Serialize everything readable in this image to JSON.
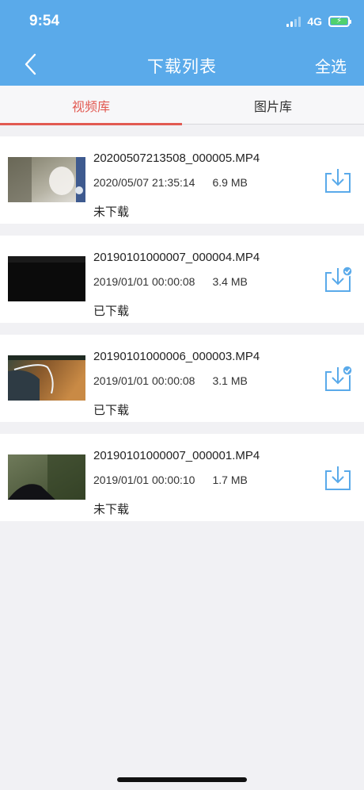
{
  "status_bar": {
    "time": "9:54",
    "network": "4G"
  },
  "nav": {
    "title": "下载列表",
    "select_all": "全选"
  },
  "tabs": [
    {
      "label": "视频库",
      "active": true
    },
    {
      "label": "图片库",
      "active": false
    }
  ],
  "files": [
    {
      "name": "20200507213508_000005.MP4",
      "date": "2020/05/07 21:35:14",
      "size": "6.9 MB",
      "status": "未下载",
      "downloaded": false
    },
    {
      "name": "20190101000007_000004.MP4",
      "date": "2019/01/01 00:00:08",
      "size": "3.4 MB",
      "status": "已下载",
      "downloaded": true
    },
    {
      "name": "20190101000006_000003.MP4",
      "date": "2019/01/01 00:00:08",
      "size": "3.1 MB",
      "status": "已下载",
      "downloaded": true
    },
    {
      "name": "20190101000007_000001.MP4",
      "date": "2019/01/01 00:00:10",
      "size": "1.7 MB",
      "status": "未下载",
      "downloaded": false
    }
  ],
  "colors": {
    "header": "#5aaaea",
    "accent_red": "#e25a52",
    "icon_blue": "#5aaaea"
  }
}
